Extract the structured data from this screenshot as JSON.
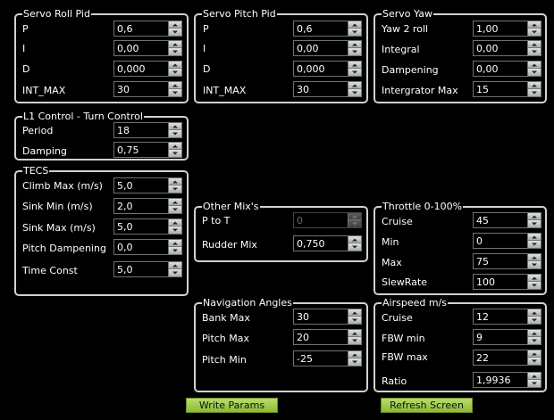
{
  "servo_roll_pid": {
    "title": "Servo Roll Pid",
    "p_label": "P",
    "p": "0,6",
    "i_label": "I",
    "i": "0,00",
    "d_label": "D",
    "d": "0,000",
    "int_max_label": "INT_MAX",
    "int_max": "30"
  },
  "servo_pitch_pid": {
    "title": "Servo Pitch Pid",
    "p_label": "P",
    "p": "0,6",
    "i_label": "I",
    "i": "0,00",
    "d_label": "D",
    "d": "0,000",
    "int_max_label": "INT_MAX",
    "int_max": "30"
  },
  "servo_yaw": {
    "title": "Servo Yaw",
    "yaw2roll_label": "Yaw 2 roll",
    "yaw2roll": "1,00",
    "integral_label": "Integral",
    "integral": "0,00",
    "dampening_label": "Dampening",
    "dampening": "0,00",
    "integrator_max_label": "Intergrator Max",
    "integrator_max": "15"
  },
  "l1_control": {
    "title": "L1 Control - Turn Control",
    "period_label": "Period",
    "period": "18",
    "damping_label": "Damping",
    "damping": "0,75"
  },
  "tecs": {
    "title": "TECS",
    "climb_max_label": "Climb Max (m/s)",
    "climb_max": "5,0",
    "sink_min_label": "Sink Min (m/s)",
    "sink_min": "2,0",
    "sink_max_label": "Sink Max (m/s)",
    "sink_max": "5,0",
    "pitch_damp_label": "Pitch Dampening",
    "pitch_damp": "0,0",
    "time_const_label": "Time Const",
    "time_const": "5,0"
  },
  "other_mix": {
    "title": "Other Mix's",
    "p_to_t_label": "P to T",
    "p_to_t": "0",
    "rudder_mix_label": "Rudder Mix",
    "rudder_mix": "0,750"
  },
  "throttle": {
    "title": "Throttle 0-100%",
    "cruise_label": "Cruise",
    "cruise": "45",
    "min_label": "Min",
    "min": "0",
    "max_label": "Max",
    "max": "75",
    "slewrate_label": "SlewRate",
    "slewrate": "100"
  },
  "nav_angles": {
    "title": "Navigation Angles",
    "bank_max_label": "Bank Max",
    "bank_max": "30",
    "pitch_max_label": "Pitch Max",
    "pitch_max": "20",
    "pitch_min_label": "Pitch Min",
    "pitch_min": "-25"
  },
  "airspeed": {
    "title": "Airspeed m/s",
    "cruise_label": "Cruise",
    "cruise": "12",
    "fbw_min_label": "FBW min",
    "fbw_min": "9",
    "fbw_max_label": "FBW max",
    "fbw_max": "22",
    "ratio_label": "Ratio",
    "ratio": "1,9936"
  },
  "buttons": {
    "write_params": "Write Params",
    "refresh_screen": "Refresh Screen"
  }
}
